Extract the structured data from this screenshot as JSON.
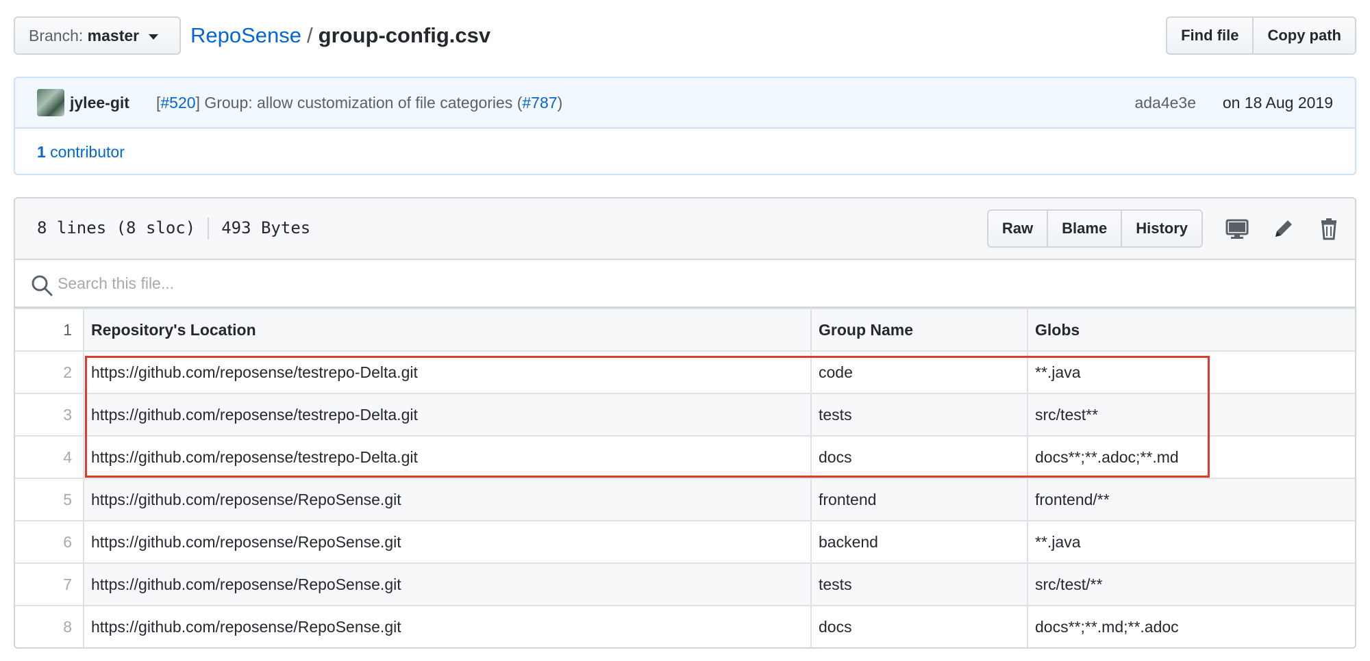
{
  "branch": {
    "label": "Branch:",
    "value": "master"
  },
  "breadcrumb": {
    "repo": "RepoSense",
    "separator": "/",
    "file": "group-config.csv"
  },
  "top_actions": {
    "find_file": "Find file",
    "copy_path": "Copy path"
  },
  "commit": {
    "author": "jylee-git",
    "pr_open": "[",
    "pr_ref": "#520",
    "pr_close": "]",
    "message": " Group: allow customization of file categories (",
    "issue_ref": "#787",
    "message_end": ")",
    "sha": "ada4e3e",
    "date": "on 18 Aug 2019"
  },
  "contributors": {
    "count": "1",
    "label": " contributor"
  },
  "file": {
    "lines": "8 lines (8 sloc)",
    "size": "493 Bytes",
    "actions": {
      "raw": "Raw",
      "blame": "Blame",
      "history": "History"
    },
    "icons": [
      "desktop-icon",
      "pencil-icon",
      "trash-icon"
    ]
  },
  "search": {
    "placeholder": "Search this file..."
  },
  "table": {
    "header_line": "1",
    "headers": [
      "Repository's Location",
      "Group Name",
      "Globs"
    ],
    "rows": [
      {
        "line": "2",
        "cells": [
          "https://github.com/reposense/testrepo-Delta.git",
          "code",
          "**.java"
        ]
      },
      {
        "line": "3",
        "cells": [
          "https://github.com/reposense/testrepo-Delta.git",
          "tests",
          "src/test**"
        ]
      },
      {
        "line": "4",
        "cells": [
          "https://github.com/reposense/testrepo-Delta.git",
          "docs",
          "docs**;**.adoc;**.md"
        ]
      },
      {
        "line": "5",
        "cells": [
          "https://github.com/reposense/RepoSense.git",
          "frontend",
          "frontend/**"
        ]
      },
      {
        "line": "6",
        "cells": [
          "https://github.com/reposense/RepoSense.git",
          "backend",
          "**.java"
        ]
      },
      {
        "line": "7",
        "cells": [
          "https://github.com/reposense/RepoSense.git",
          "tests",
          "src/test/**"
        ]
      },
      {
        "line": "8",
        "cells": [
          "https://github.com/reposense/RepoSense.git",
          "docs",
          "docs**;**.md;**.adoc"
        ]
      }
    ]
  },
  "colors": {
    "link": "#0366d6",
    "highlight": "#e03a2c",
    "border": "#d1d5da"
  }
}
